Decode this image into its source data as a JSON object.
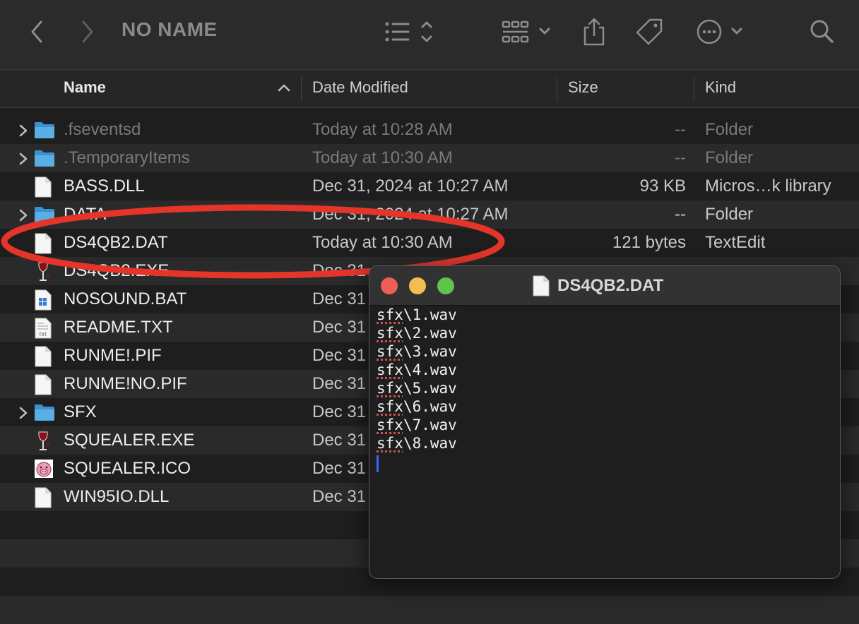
{
  "toolbar": {
    "title": "NO NAME",
    "back_icon": "chevron-left-icon",
    "forward_icon": "chevron-right-icon"
  },
  "columns": {
    "name": "Name",
    "date": "Date Modified",
    "size": "Size",
    "kind": "Kind"
  },
  "files": [
    {
      "name": ".fseventsd",
      "date": "Today at 10:28 AM",
      "size": "--",
      "kind": "Folder",
      "icon": "folder-icon",
      "expandable": true,
      "dim": true
    },
    {
      "name": ".TemporaryItems",
      "date": "Today at 10:30 AM",
      "size": "--",
      "kind": "Folder",
      "icon": "folder-icon",
      "expandable": true,
      "dim": true
    },
    {
      "name": "BASS.DLL",
      "date": "Dec 31, 2024 at 10:27 AM",
      "size": "93 KB",
      "kind": "Micros…k library",
      "icon": "document-icon",
      "expandable": false,
      "dim": false
    },
    {
      "name": "DATA",
      "date": "Dec 31, 2024 at 10:27 AM",
      "size": "--",
      "kind": "Folder",
      "icon": "folder-icon",
      "expandable": true,
      "dim": false
    },
    {
      "name": "DS4QB2.DAT",
      "date": "Today at 10:30 AM",
      "size": "121 bytes",
      "kind": "TextEdit",
      "icon": "document-icon",
      "expandable": false,
      "dim": false
    },
    {
      "name": "DS4QB2.EXE",
      "date": "Dec 31",
      "size": "",
      "kind": "",
      "icon": "wine-icon",
      "expandable": false,
      "dim": false
    },
    {
      "name": "NOSOUND.BAT",
      "date": "Dec 31",
      "size": "",
      "kind": "",
      "icon": "batch-file-icon",
      "expandable": false,
      "dim": false
    },
    {
      "name": "README.TXT",
      "date": "Dec 31",
      "size": "",
      "kind": "",
      "icon": "text-file-icon",
      "expandable": false,
      "dim": false
    },
    {
      "name": "RUNME!.PIF",
      "date": "Dec 31",
      "size": "",
      "kind": "",
      "icon": "document-icon",
      "expandable": false,
      "dim": false
    },
    {
      "name": "RUNME!NO.PIF",
      "date": "Dec 31",
      "size": "",
      "kind": "",
      "icon": "document-icon",
      "expandable": false,
      "dim": false
    },
    {
      "name": "SFX",
      "date": "Dec 31",
      "size": "",
      "kind": "",
      "icon": "folder-icon",
      "expandable": true,
      "dim": false
    },
    {
      "name": "SQUEALER.EXE",
      "date": "Dec 31",
      "size": "",
      "kind": "",
      "icon": "wine-icon",
      "expandable": false,
      "dim": false
    },
    {
      "name": "SQUEALER.ICO",
      "date": "Dec 31",
      "size": "",
      "kind": "",
      "icon": "pig-icon",
      "expandable": false,
      "dim": false
    },
    {
      "name": "WIN95IO.DLL",
      "date": "Dec 31",
      "size": "",
      "kind": "",
      "icon": "document-icon",
      "expandable": false,
      "dim": false
    }
  ],
  "textedit": {
    "title": "DS4QB2.DAT",
    "lines": [
      {
        "a": "sfx",
        "b": "\\1.wav"
      },
      {
        "a": "sfx",
        "b": "\\2.wav"
      },
      {
        "a": "sfx",
        "b": "\\3.wav"
      },
      {
        "a": "sfx",
        "b": "\\4.wav"
      },
      {
        "a": "sfx",
        "b": "\\5.wav"
      },
      {
        "a": "sfx",
        "b": "\\6.wav"
      },
      {
        "a": "sfx",
        "b": "\\7.wav"
      },
      {
        "a": "sfx",
        "b": "\\8.wav"
      }
    ]
  },
  "colors": {
    "annotation": "#e5352a",
    "folder": "#4a9fd8"
  }
}
